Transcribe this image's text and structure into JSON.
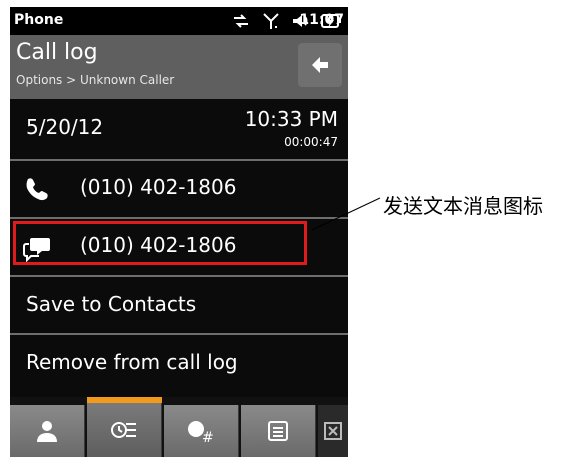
{
  "status_bar": {
    "app_name": "Phone",
    "time": "11:07"
  },
  "header": {
    "title": "Call log",
    "subtitle": "Options > Unknown Caller"
  },
  "call_info": {
    "date": "5/20/12",
    "time": "10:33 PM",
    "duration": "00:00:47"
  },
  "actions": {
    "call_number": "(010) 402-1806",
    "message_number": "(010) 402-1806",
    "save_label": "Save to Contacts",
    "remove_label": "Remove from call log"
  },
  "tabs": [
    {
      "icon": "contact-icon"
    },
    {
      "icon": "call-log-icon",
      "active": true
    },
    {
      "icon": "dialpad-icon"
    },
    {
      "icon": "menu-icon"
    },
    {
      "icon": "close-icon"
    }
  ],
  "annotation": {
    "text": "发送文本消息图标",
    "color": "#e11b1b"
  },
  "colors": {
    "accent": "#f39a1d",
    "header_bg": "#5f5f5f",
    "highlight": "#e11b1b"
  }
}
